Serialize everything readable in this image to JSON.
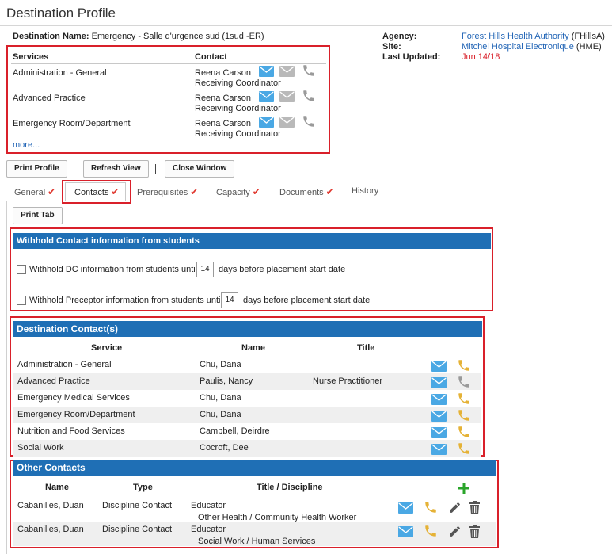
{
  "page": {
    "title": "Destination Profile"
  },
  "destination": {
    "label": "Destination Name:",
    "value": "Emergency - Salle d'urgence sud (1sud -ER)"
  },
  "meta": {
    "agency_label": "Agency:",
    "agency_value": "Forest Hills Health Authority",
    "agency_code": "(FHillsA)",
    "site_label": "Site:",
    "site_value": "Mitchel Hospital Electronique",
    "site_code": "(HME)",
    "updated_label": "Last Updated:",
    "updated_value": "Jun 14/18"
  },
  "services_panel": {
    "col_services": "Services",
    "col_contact": "Contact",
    "items": [
      {
        "service": "Administration - General",
        "contact": "Reena Carson",
        "role": "Receiving Coordinator"
      },
      {
        "service": "Advanced Practice",
        "contact": "Reena Carson",
        "role": "Receiving Coordinator"
      },
      {
        "service": "Emergency Room/Department",
        "contact": "Reena Carson",
        "role": "Receiving Coordinator"
      }
    ],
    "more_link": "more..."
  },
  "toolbar": {
    "print_profile": "Print Profile",
    "refresh_view": "Refresh View",
    "close_window": "Close Window"
  },
  "tabs": [
    {
      "label": "General",
      "checked": true
    },
    {
      "label": "Contacts",
      "checked": true,
      "active": true
    },
    {
      "label": "Prerequisites",
      "checked": true
    },
    {
      "label": "Capacity",
      "checked": true
    },
    {
      "label": "Documents",
      "checked": true
    },
    {
      "label": "History",
      "checked": false
    }
  ],
  "print_tab": "Print Tab",
  "withhold": {
    "header": "Withhold Contact information from students",
    "dc_prefix": "Withhold DC information from students until",
    "dc_days": "14",
    "dc_suffix": "days before placement start date",
    "preceptor_prefix": "Withhold Preceptor information from students until",
    "preceptor_days": "14",
    "preceptor_suffix": "days before placement start date"
  },
  "destination_contacts": {
    "header": "Destination Contact(s)",
    "col_service": "Service",
    "col_name": "Name",
    "col_title": "Title",
    "rows": [
      {
        "service": "Administration - General",
        "name": "Chu, Dana",
        "title": "",
        "phone": "active"
      },
      {
        "service": "Advanced Practice",
        "name": "Paulis, Nancy",
        "title": "Nurse Practitioner",
        "phone": "disabled"
      },
      {
        "service": "Emergency Medical Services",
        "name": "Chu, Dana",
        "title": "",
        "phone": "active"
      },
      {
        "service": "Emergency Room/Department",
        "name": "Chu, Dana",
        "title": "",
        "phone": "active"
      },
      {
        "service": "Nutrition and Food Services",
        "name": "Campbell, Deirdre",
        "title": "",
        "phone": "active"
      },
      {
        "service": "Social Work",
        "name": "Cocroft, Dee",
        "title": "",
        "phone": "active"
      }
    ]
  },
  "other_contacts": {
    "header": "Other Contacts",
    "col_name": "Name",
    "col_type": "Type",
    "col_title": "Title / Discipline",
    "rows": [
      {
        "name": "Cabanilles, Duan",
        "type": "Discipline Contact",
        "title": "Educator",
        "discipline": "Other Health / Community Health Worker"
      },
      {
        "name": "Cabanilles, Duan",
        "type": "Discipline Contact",
        "title": "Educator",
        "discipline": "Social Work / Human Services"
      }
    ]
  },
  "colors": {
    "accent_blue": "#1f6fb5",
    "link_blue": "#1f63b5",
    "highlight_red": "#d9202a",
    "mail_blue": "#4aa8e4",
    "phone_gold": "#e5b236",
    "icon_gray": "#9a9a9a",
    "add_green": "#2aa52a"
  },
  "icons": [
    "mail-icon",
    "phone-icon",
    "pencil-icon",
    "trash-icon",
    "plus-icon",
    "checkmark-icon"
  ]
}
